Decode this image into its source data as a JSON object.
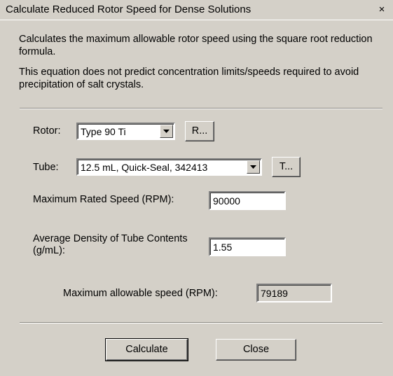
{
  "window": {
    "title": "Calculate Reduced Rotor Speed for Dense Solutions",
    "close_label": "×"
  },
  "description": {
    "line1": "Calculates the maximum allowable rotor speed using the square root reduction formula.",
    "line2": "This equation does not predict concentration limits/speeds required to avoid precipitation of salt crystals."
  },
  "rotor": {
    "label": "Rotor:",
    "selected": "Type  90 Ti",
    "button_label": "R..."
  },
  "tube": {
    "label": "Tube:",
    "selected": "12.5 mL, Quick-Seal, 342413",
    "button_label": "T..."
  },
  "max_rated_speed": {
    "label": "Maximum Rated Speed (RPM):",
    "value": "90000"
  },
  "avg_density": {
    "label": "Average Density of Tube Contents (g/mL):",
    "value": "1.55"
  },
  "result": {
    "label": "Maximum allowable speed (RPM):",
    "value": "79189"
  },
  "buttons": {
    "calculate": "Calculate",
    "close": "Close"
  },
  "colors": {
    "dialog_face": "#d4d0c8",
    "field_bg": "#ffffff"
  },
  "icons": {
    "dropdown": "chevron-down-icon",
    "close": "close-icon"
  }
}
